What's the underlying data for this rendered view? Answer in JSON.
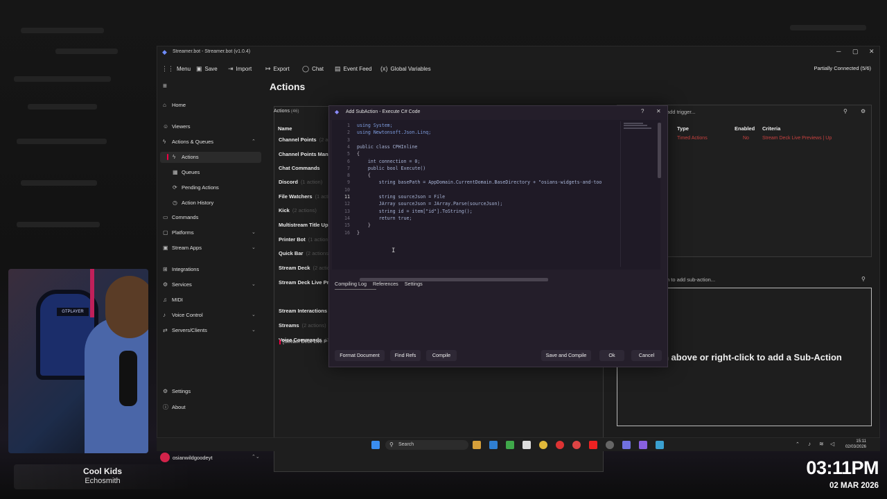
{
  "window": {
    "title": "Streamer.bot - Streamer.bot (v1.0.4)"
  },
  "toolbar": {
    "menu": "Menu",
    "save": "Save",
    "import": "Import",
    "export": "Export",
    "chat": "Chat",
    "event_feed": "Event Feed",
    "global_variables": "Global Variables",
    "status": "Partially Connected (5/6)"
  },
  "sidebar": {
    "items": [
      "Home",
      "Viewers",
      "Actions & Queues",
      "Actions",
      "Queues",
      "Pending Actions",
      "Action History",
      "Commands",
      "Platforms",
      "Stream Apps",
      "Integrations",
      "Services",
      "MIDI",
      "Voice Control",
      "Servers/Clients",
      "Settings",
      "About"
    ],
    "user": "osianwildgoodeyt"
  },
  "actions": {
    "title": "Actions",
    "header": "Actions",
    "count": "(46)",
    "col_name": "Name",
    "groups": [
      "Channel Points",
      "Channel Points Man",
      "Chat Commands",
      "Discord",
      "File Watchers",
      "Kick",
      "Multistream Title Up",
      "Printer Bot",
      "Quick Bar",
      "Stream Deck",
      "Stream Deck Live Pr",
      "Stream Interactions",
      "Streams",
      "Voice Commands"
    ],
    "group_counts": [
      "(2 actions)",
      "",
      "",
      "(1 action)",
      "(1 action)",
      "(2 actions)",
      "",
      "(1 action)",
      "(2 actions)",
      "(2 actions)",
      "",
      "",
      "(2 actions)",
      "(2 actions)"
    ],
    "item": "[Stream Deck Live P"
  },
  "triggers": {
    "search_placeholder": "add trigger...",
    "columns": [
      "Type",
      "Enabled",
      "Criteria"
    ],
    "row": {
      "type": "Timed Actions",
      "enabled": "No",
      "criteria": "Stream Deck Live Previews | Up"
    }
  },
  "subactions": {
    "search_placeholder": "h to add sub-action...",
    "message": "h above or right-click to add a Sub-Action"
  },
  "dialog": {
    "title": "Add SubAction - Execute C# Code",
    "help": "?",
    "code": [
      {
        "n": "1",
        "t": "using System;"
      },
      {
        "n": "2",
        "t": "using Newtonsoft.Json.Linq;"
      },
      {
        "n": "3",
        "t": ""
      },
      {
        "n": "4",
        "t": "public class CPHInline"
      },
      {
        "n": "5",
        "t": "{"
      },
      {
        "n": "6",
        "t": "    int connection = 0;"
      },
      {
        "n": "7",
        "t": "    public bool Execute()"
      },
      {
        "n": "8",
        "t": "    {"
      },
      {
        "n": "9",
        "t": "        string basePath = AppDomain.CurrentDomain.BaseDirectory + \"osians-widgets-and-too"
      },
      {
        "n": "10",
        "t": ""
      },
      {
        "n": "11",
        "t": "        string sourceJson = File"
      },
      {
        "n": "12",
        "t": "        JArray sourceJson = JArray.Parse(sourceJson);"
      },
      {
        "n": "13",
        "t": "        string id = item[\"id\"].ToString();"
      },
      {
        "n": "14",
        "t": "        return true;"
      },
      {
        "n": "15",
        "t": "    }"
      },
      {
        "n": "16",
        "t": "}"
      }
    ],
    "tabs": [
      "Compiling Log",
      "References",
      "Settings"
    ],
    "buttons": {
      "format": "Format Document",
      "find_refs": "Find Refs",
      "compile": "Compile",
      "save_compile": "Save and Compile",
      "ok": "Ok",
      "cancel": "Cancel"
    }
  },
  "taskbar": {
    "search": "Search",
    "time": "15:11",
    "date": "02/03/2026"
  },
  "overlay": {
    "song_title": "Cool Kids",
    "song_artist": "Echosmith",
    "clock": "03:11PM",
    "date": "02 MAR 2026"
  },
  "colors": {
    "accent": "#e0004a",
    "trigger_row": "#c8413f",
    "dialog_bg": "#241e2a"
  }
}
